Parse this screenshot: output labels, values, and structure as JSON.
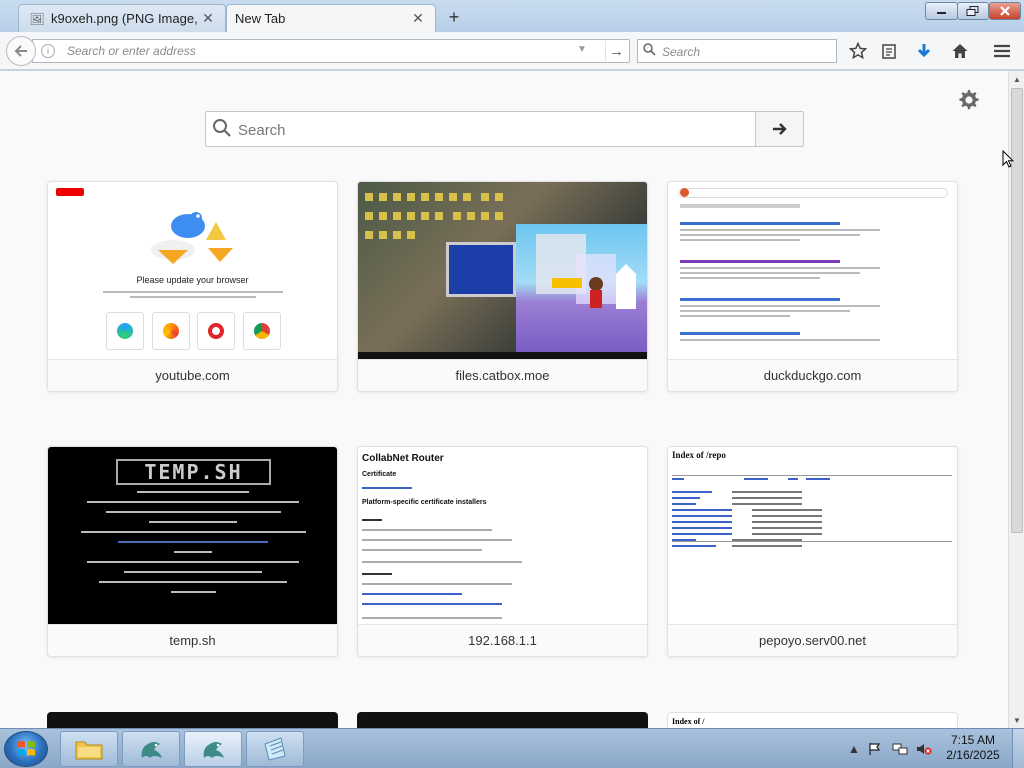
{
  "browser": {
    "tabs": [
      {
        "label": "k9oxeh.png (PNG Image, 19",
        "favicon": "image-icon",
        "active": false
      },
      {
        "label": "New Tab",
        "favicon": "",
        "active": true
      }
    ],
    "new_tab_glyph": "+",
    "close_glyph": "✕",
    "address_placeholder": "Search or enter address",
    "search_placeholder": "Search"
  },
  "newtab": {
    "search_placeholder": "Search",
    "tiles": [
      {
        "title": "youtube.com",
        "thumb_heading": "Please update your browser"
      },
      {
        "title": "files.catbox.moe"
      },
      {
        "title": "duckduckgo.com"
      },
      {
        "title": "temp.sh",
        "thumb_heading": "TEMP.SH"
      },
      {
        "title": "192.168.1.1",
        "thumb_heading": "CollabNet Router",
        "thumb_sub1": "Certificate",
        "thumb_sub2": "Platform-specific certificate installers"
      },
      {
        "title": "pepoyo.serv00.net",
        "thumb_heading": "Index of /repo"
      }
    ],
    "partial_tile_heading": "Index of /"
  },
  "taskbar": {
    "time": "7:15 AM",
    "date": "2/16/2025"
  },
  "colors": {
    "accent_blue": "#0a84ff",
    "download_arrow": "#1b7ad6",
    "window_close": "#c7412a"
  }
}
